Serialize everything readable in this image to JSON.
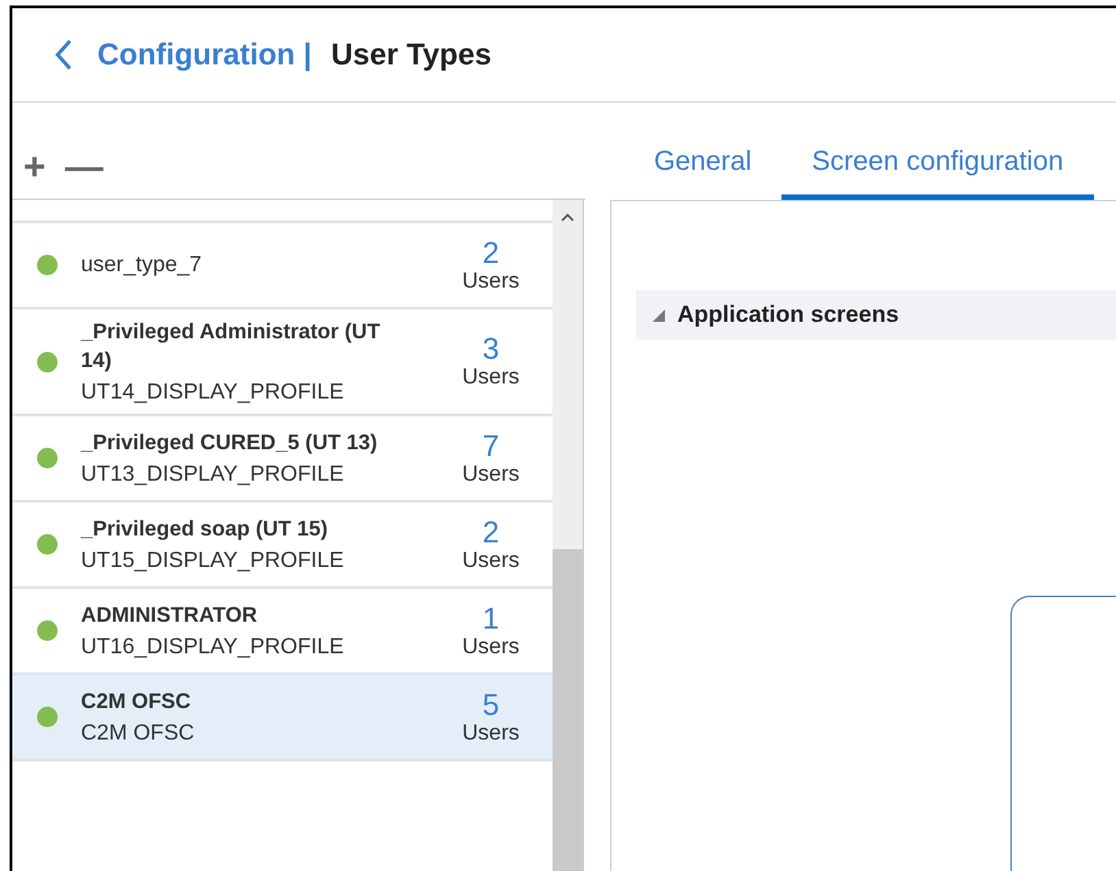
{
  "header": {
    "breadcrumb": "Configuration |",
    "title": "User Types"
  },
  "toolbar": {
    "add": "+",
    "remove": "—"
  },
  "tabs": [
    {
      "label": "General",
      "selected": false
    },
    {
      "label": "Screen configuration",
      "selected": true
    }
  ],
  "user_types": [
    {
      "name": "user_type_7",
      "bold": false,
      "color": "#84bd4f",
      "count": "2",
      "unit": "Users",
      "selected": false
    },
    {
      "name": "_Privileged Administrator (UT 14)",
      "bold": true,
      "profile": "UT14_DISPLAY_PROFILE",
      "color": "#84bd4f",
      "count": "3",
      "unit": "Users",
      "selected": false
    },
    {
      "name": "_Privileged CURED_5 (UT 13)",
      "bold": true,
      "profile": "UT13_DISPLAY_PROFILE",
      "color": "#84bd4f",
      "count": "7",
      "unit": "Users",
      "selected": false
    },
    {
      "name": "_Privileged soap (UT 15)",
      "bold": true,
      "profile": "UT15_DISPLAY_PROFILE",
      "color": "#84bd4f",
      "count": "2",
      "unit": "Users",
      "selected": false
    },
    {
      "name": "ADMINISTRATOR",
      "bold": true,
      "profile": "UT16_DISPLAY_PROFILE",
      "color": "#84bd4f",
      "count": "1",
      "unit": "Users",
      "selected": false
    },
    {
      "name": "C2M OFSC",
      "bold": true,
      "profile": "C2M OFSC",
      "color": "#84bd4f",
      "count": "5",
      "unit": "Users",
      "selected": true
    }
  ],
  "section": {
    "title": "Application screens",
    "expanded": true
  }
}
